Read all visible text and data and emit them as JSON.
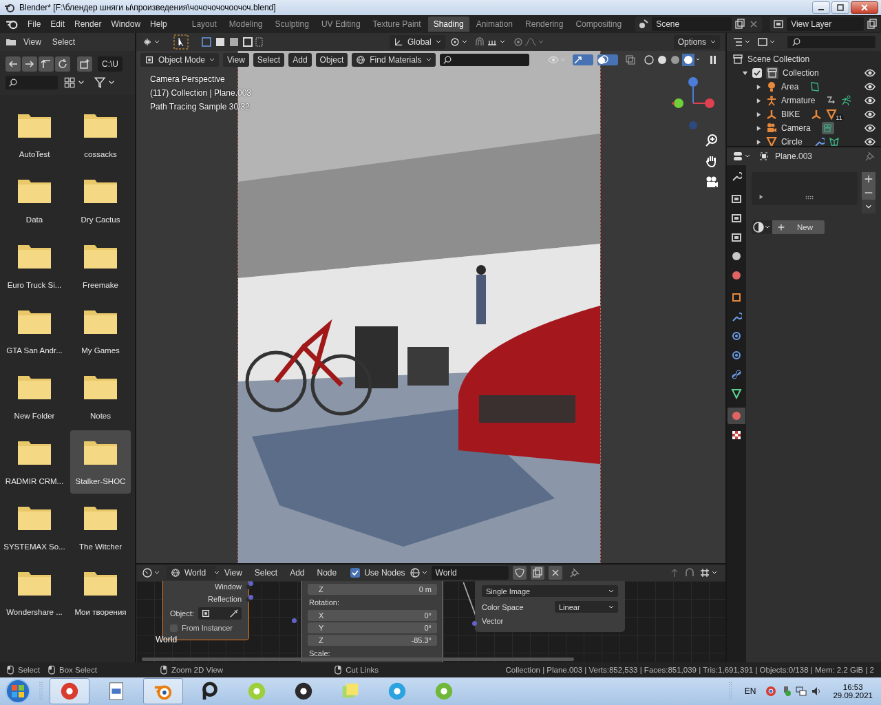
{
  "window": {
    "title": "Blender* [F:\\блендер шняги ы\\произведения\\чочочочочоочоч.blend]"
  },
  "menu": [
    "File",
    "Edit",
    "Render",
    "Window",
    "Help"
  ],
  "workspaces": [
    {
      "label": "Layout",
      "selected": false
    },
    {
      "label": "Modeling",
      "selected": false
    },
    {
      "label": "Sculpting",
      "selected": false
    },
    {
      "label": "UV Editing",
      "selected": false
    },
    {
      "label": "Texture Paint",
      "selected": false
    },
    {
      "label": "Shading",
      "selected": true
    },
    {
      "label": "Animation",
      "selected": false
    },
    {
      "label": "Rendering",
      "selected": false
    },
    {
      "label": "Compositing",
      "selected": false
    }
  ],
  "scene": "Scene",
  "view_layer": "View Layer",
  "file_browser": {
    "menu": [
      "View",
      "Select"
    ],
    "path": "C:\\U",
    "items": [
      {
        "name": "AutoTest",
        "selected": false
      },
      {
        "name": "cossacks",
        "selected": false
      },
      {
        "name": "Data",
        "selected": false
      },
      {
        "name": "Dry Cactus",
        "selected": false
      },
      {
        "name": "Euro Truck Si...",
        "selected": false
      },
      {
        "name": "Freemake",
        "selected": false
      },
      {
        "name": "GTA San Andr...",
        "selected": false
      },
      {
        "name": "My Games",
        "selected": false
      },
      {
        "name": "New Folder",
        "selected": false
      },
      {
        "name": "Notes",
        "selected": false
      },
      {
        "name": "RADMIR CRM...",
        "selected": false
      },
      {
        "name": "Stalker-SHOC",
        "selected": true
      },
      {
        "name": "SYSTEMAX So...",
        "selected": false
      },
      {
        "name": "The Witcher",
        "selected": false
      },
      {
        "name": "Wondershare ...",
        "selected": false
      },
      {
        "name": "Мои творения",
        "selected": false
      }
    ]
  },
  "viewport": {
    "orientation": "Global",
    "options": "Options",
    "mode": "Object Mode",
    "menu": [
      "View",
      "Select",
      "Add",
      "Object"
    ],
    "find": "Find Materials",
    "overlay": [
      "Camera Perspective",
      "(117) Collection | Plane.003",
      "Path Tracing Sample 30/32"
    ]
  },
  "node_editor": {
    "shader_type": "World",
    "menu": [
      "View",
      "Select",
      "Add",
      "Node"
    ],
    "use_nodes": {
      "label": "Use Nodes",
      "checked": true
    },
    "world": "World",
    "coord_node": {
      "outputs": [
        "Window",
        "Reflection"
      ],
      "object_label": "Object:",
      "from_instancer": {
        "label": "From Instancer",
        "checked": false
      },
      "frame_label": "World"
    },
    "mapping_node": {
      "location_z": {
        "label": "Z",
        "value": "0 m"
      },
      "rotation_label": "Rotation:",
      "rotation": [
        {
          "label": "X",
          "value": "0°"
        },
        {
          "label": "Y",
          "value": "0°"
        },
        {
          "label": "Z",
          "value": "-85.3°"
        }
      ],
      "scale_label": "Scale:"
    },
    "image_node": {
      "projection": "Single Image",
      "color_space_label": "Color Space",
      "color_space": "Linear",
      "input": "Vector"
    }
  },
  "outliner": {
    "scene_collection": "Scene Collection",
    "collection": {
      "name": "Collection",
      "checked": true,
      "expanded": true,
      "children": [
        {
          "name": "Area",
          "kind": "light",
          "expanded": false
        },
        {
          "name": "Armature",
          "kind": "armature",
          "expanded": false
        },
        {
          "name": "BIKE",
          "kind": "empty",
          "expanded": false,
          "badge": "11"
        },
        {
          "name": "Camera",
          "kind": "camera",
          "expanded": false
        },
        {
          "name": "Circle",
          "kind": "mesh",
          "expanded": false
        }
      ]
    }
  },
  "properties": {
    "object": "Plane.003",
    "new": "New",
    "tabs": [
      {
        "kind": "tool",
        "selected": false
      },
      {
        "kind": "render",
        "selected": false
      },
      {
        "kind": "output",
        "selected": false
      },
      {
        "kind": "view_layer",
        "selected": false
      },
      {
        "kind": "scene",
        "selected": false
      },
      {
        "kind": "world",
        "selected": false
      },
      {
        "kind": "object",
        "selected": false
      },
      {
        "kind": "modifiers",
        "selected": false
      },
      {
        "kind": "particles",
        "selected": false
      },
      {
        "kind": "physics",
        "selected": false
      },
      {
        "kind": "constraints",
        "selected": false
      },
      {
        "kind": "data",
        "selected": false
      },
      {
        "kind": "material",
        "selected": true
      },
      {
        "kind": "texture",
        "selected": false
      }
    ]
  },
  "status_bar": {
    "hints": [
      "Select",
      "Box Select",
      "Zoom 2D View",
      "Cut Links"
    ],
    "stats": "Collection | Plane.003 | Verts:852,533 | Faces:851,039 | Tris:1,691,391 | Objects:0/138 | Mem: 2.2 GiB | 2"
  },
  "taskbar": {
    "apps": [
      {
        "kind": "browser",
        "open": true
      },
      {
        "kind": "document",
        "open": false
      },
      {
        "kind": "blender",
        "open": true
      },
      {
        "kind": "letter",
        "open": false
      },
      {
        "kind": "lime",
        "open": false
      },
      {
        "kind": "arrow",
        "open": false
      },
      {
        "kind": "notes",
        "open": false
      },
      {
        "kind": "telegram",
        "open": false
      },
      {
        "kind": "torrent",
        "open": false
      }
    ],
    "lang": "EN",
    "time": "16:53",
    "date": "29.09.2021"
  }
}
